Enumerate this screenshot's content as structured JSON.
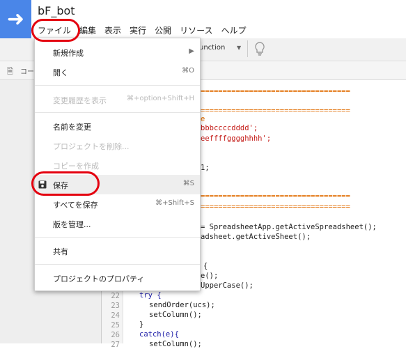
{
  "app": {
    "title": "bF_bot"
  },
  "menubar": [
    "ファイル",
    "編集",
    "表示",
    "実行",
    "公開",
    "リソース",
    "ヘルプ"
  ],
  "toolbar": {
    "function_select": "unction"
  },
  "filetab": {
    "label": "コー"
  },
  "file_menu": {
    "new": "新規作成",
    "open": "開く",
    "open_shortcut": "⌘O",
    "history": "変更履歴を表示",
    "history_shortcut": "⌘+option+Shift+H",
    "rename": "名前を変更",
    "delete": "プロジェクトを削除...",
    "copy": "コピーを作成",
    "save": "保存",
    "save_shortcut": "⌘S",
    "save_all": "すべてを保存",
    "save_all_shortcut": "⌘+Shift+S",
    "versions": "版を管理...",
    "share": "共有",
    "properties": "プロジェクトのプロパティ"
  },
  "code": {
    "line_numbers": [
      "22",
      "23",
      "24",
      "25",
      "26",
      "27"
    ],
    "l1": "==================================",
    "l2": "==================================",
    "l3a": "e",
    "l4": "bbbccccdddd';",
    "l5": "eeffffgggghhhh';",
    "l6": "1;",
    "l7": "==================================",
    "l8": "==================================",
    "l9": "= SpreadsheetApp.getActiveSpreadsheet();",
    "l10": "adsheet.getActiveSheet();",
    "l11": "{",
    "l12": "e();",
    "l13": "UpperCase();",
    "l14": "try {",
    "l15": "sendOrder(ucs);",
    "l16": "setColumn();",
    "l17": "}",
    "l18": "catch(e){",
    "l19": "setColumn();"
  }
}
